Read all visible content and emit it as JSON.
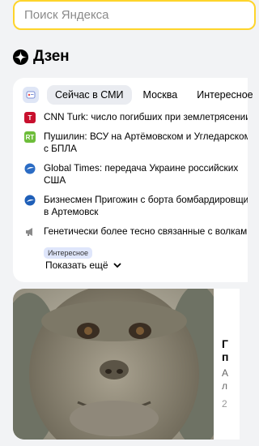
{
  "search": {
    "placeholder": "Поиск Яндекса"
  },
  "dzen": {
    "title": "Дзен"
  },
  "news_card": {
    "tabs": [
      {
        "label": "Сейчас в СМИ",
        "active": true
      },
      {
        "label": "Москва",
        "active": false
      },
      {
        "label": "Интересное",
        "active": false
      }
    ],
    "items": [
      {
        "source_icon": "cnn-turk-logo",
        "text": "CNN Turk: число погибших при землетрясении"
      },
      {
        "source_icon": "rt-logo",
        "text": "Пушилин: ВСУ на Артёмовском и Угледарском",
        "text2": "с БПЛА"
      },
      {
        "source_icon": "global-times-logo",
        "text": "Global Times: передача Украине российских",
        "text2": "США"
      },
      {
        "source_icon": "globe-logo",
        "text": "Бизнесмен Пригожин с борта бомбардировщика",
        "text2": "в Артемовск"
      },
      {
        "source_icon": "megaphone-icon",
        "text": "Генетически более тесно связанные с волками",
        "badge": "Интересное"
      }
    ],
    "show_more": "Показать ещё"
  },
  "photo_card": {
    "side_letters": [
      "Г",
      "п",
      "А",
      "л",
      "2"
    ]
  },
  "colors": {
    "accent": "#fed42b",
    "page_bg": "#f2f3f5",
    "active_tab_bg": "#eaecf1"
  }
}
